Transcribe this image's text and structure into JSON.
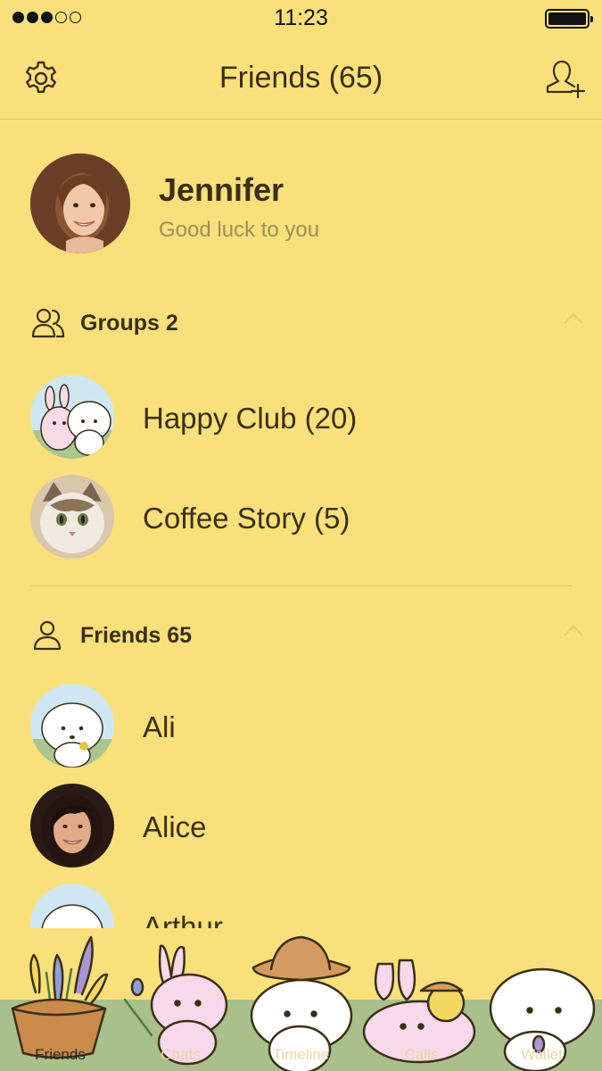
{
  "status_bar": {
    "time": "11:23",
    "signal_bars_filled": 3,
    "signal_bars_total": 5,
    "battery_level": 1.0
  },
  "nav": {
    "title": "Friends (65)",
    "left_icon": "gear-icon",
    "right_icon": "add-friend-icon"
  },
  "profile": {
    "name": "Jennifer",
    "status": "Good luck to you"
  },
  "groups": {
    "header": "Groups 2",
    "items": [
      {
        "label": "Happy Club (20)",
        "avatar": "bunny-and-puppy"
      },
      {
        "label": "Coffee Story (5)",
        "avatar": "cat-photo"
      }
    ]
  },
  "friends": {
    "header": "Friends 65",
    "items": [
      {
        "label": "Ali",
        "avatar": "white-puppy"
      },
      {
        "label": "Alice",
        "avatar": "woman-photo"
      },
      {
        "label": "Arthur",
        "avatar": "white-puppy"
      }
    ]
  },
  "tabs": [
    {
      "label": "Friends",
      "active": true
    },
    {
      "label": "Chats",
      "active": false
    },
    {
      "label": "Timeline",
      "active": false
    },
    {
      "label": "Calls",
      "active": false
    },
    {
      "label": "Wallet",
      "active": false
    }
  ],
  "colors": {
    "background": "#f9e07a",
    "text": "#3b2f16",
    "muted": "#9c8d5d",
    "divider": "#dcc56a",
    "grass": "#a9c08d"
  }
}
